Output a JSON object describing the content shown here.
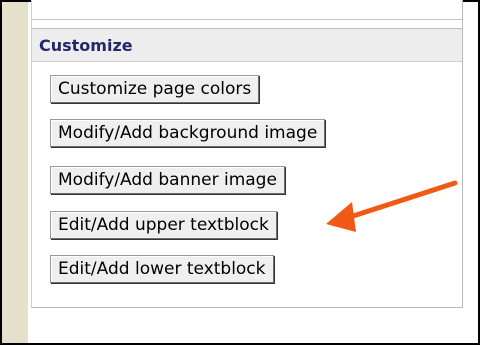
{
  "customize": {
    "title": "Customize",
    "buttons": [
      {
        "label": "Customize page colors"
      },
      {
        "label": "Modify/Add background image"
      },
      {
        "label": "Modify/Add banner image"
      },
      {
        "label": "Edit/Add upper textblock"
      },
      {
        "label": "Edit/Add lower textblock"
      }
    ]
  },
  "annotation": {
    "arrow_color": "#f05a14",
    "arrow_target": "Edit/Add upper textblock"
  },
  "colors": {
    "section_title": "#24286b",
    "left_strip": "#e4e0c9",
    "header_bg": "#ededed"
  }
}
